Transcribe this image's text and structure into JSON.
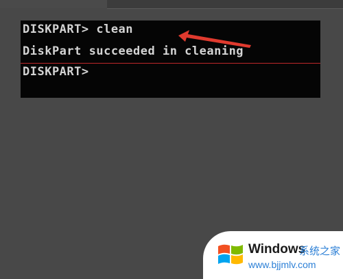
{
  "console": {
    "lines": [
      "DISKPART> clean",
      "DiskPart succeeded in cleaning",
      "DISKPART>"
    ]
  },
  "watermark": {
    "title": "Windows",
    "subtitle": "系统之家",
    "url": "www.bjjmlv.com"
  },
  "colors": {
    "background": "#484848",
    "console_bg": "#050505",
    "console_text": "#d4d4d4",
    "annotation_arrow": "#e03a2e",
    "rule": "#c0282a",
    "watermark_accent": "#2b7fd6"
  }
}
